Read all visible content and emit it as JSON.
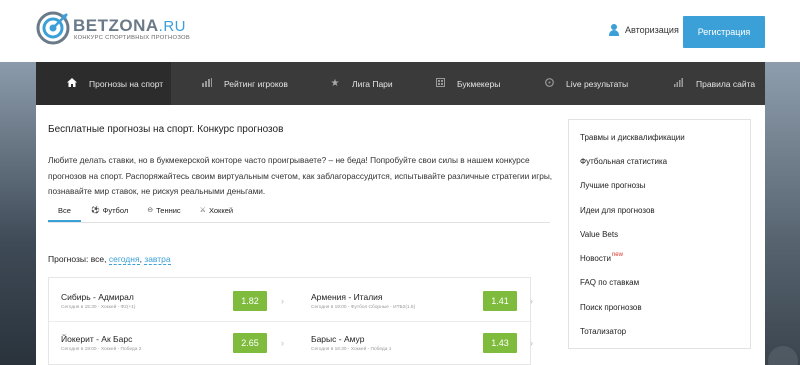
{
  "header": {
    "logo_name": "BETZONA",
    "logo_suffix": ".RU",
    "logo_tagline": "КОНКУРС СПОРТИВНЫХ ПРОГНОЗОВ",
    "auth_label": "Авторизация",
    "register_label": "Регистрация"
  },
  "nav": {
    "items": [
      {
        "label": "Прогнозы на спорт",
        "icon": "home-icon"
      },
      {
        "label": "Рейтинг игроков",
        "icon": "bar-chart-icon"
      },
      {
        "label": "Лига Пари",
        "icon": "star-icon"
      },
      {
        "label": "Букмекеры",
        "icon": "grid-icon"
      },
      {
        "label": "Live результаты",
        "icon": "clock-icon"
      },
      {
        "label": "Правила сайта",
        "icon": "stats-icon"
      }
    ]
  },
  "main": {
    "title": "Бесплатные прогнозы на спорт. Конкурс прогнозов",
    "intro": "Любите делать ставки, но в букмекерской конторе часто проигрываете? – не беда! Попробуйте свои силы в нашем конкурсе прогнозов на спорт. Распоряжайтесь своим виртуальным счетом, как заблагорассудится, испытывайте различные стратегии игры, познавайте мир ставок, не рискуя реальными деньгами.",
    "tabs": [
      {
        "label": "Все",
        "icon": ""
      },
      {
        "label": "Футбол",
        "icon": "⚽"
      },
      {
        "label": "Теннис",
        "icon": "⊖"
      },
      {
        "label": "Хоккей",
        "icon": "⚔"
      }
    ],
    "forecasts_prefix": "Прогнозы: все,",
    "forecasts_today": "сегодня",
    "forecasts_sep": ",",
    "forecasts_tomorrow": "завтра",
    "bets": [
      {
        "teams": "Сибирь - Адмирал",
        "meta": "Сегодня в 15:30 - Хоккей - Ф2(+1)",
        "odds": "1.82"
      },
      {
        "teams": "Армения - Италия",
        "meta": "Сегодня в 19:00 - Футбол Сборные - ИТБ2(1.5)",
        "odds": "1.41"
      },
      {
        "teams": "Йокерит - Ак Барс",
        "meta": "Сегодня в 19:00 - Хоккей - Победа 2",
        "odds": "2.65"
      },
      {
        "teams": "Барыс - Амур",
        "meta": "Сегодня в 16:30 - Хоккей - Победа 1",
        "odds": "1.43"
      }
    ],
    "arrow_glyph": "›"
  },
  "sidebar": {
    "items": [
      {
        "label": "Травмы и дисквалификации"
      },
      {
        "label": "Футбольная статистика"
      },
      {
        "label": "Лучшие прогнозы"
      },
      {
        "label": "Идеи для прогнозов"
      },
      {
        "label": "Value Bets"
      },
      {
        "label": "Новости",
        "badge": "new"
      },
      {
        "label": "FAQ по ставкам"
      },
      {
        "label": "Поиск прогнозов"
      },
      {
        "label": "Тотализатор"
      }
    ]
  },
  "colors": {
    "accent": "#3ba0d8",
    "odds_green": "#7fbb3d",
    "nav_bg": "#3a3a3a",
    "badge_red": "#d9342b"
  }
}
